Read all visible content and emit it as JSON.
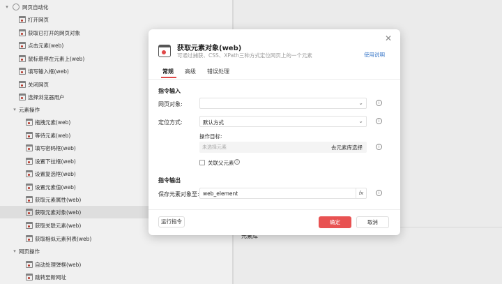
{
  "sidebar": {
    "items": [
      {
        "label": "网页自动化",
        "kind": "group"
      },
      {
        "label": "打开网页",
        "kind": "item"
      },
      {
        "label": "获取已打开的网页对象",
        "kind": "item"
      },
      {
        "label": "点击元素(web)",
        "kind": "item"
      },
      {
        "label": "鼠标悬停在元素上(web)",
        "kind": "item"
      },
      {
        "label": "填写输入框(web)",
        "kind": "item"
      },
      {
        "label": "关闭网页",
        "kind": "item"
      },
      {
        "label": "选择浏览器用户",
        "kind": "item"
      },
      {
        "label": "元素操作",
        "kind": "subgroup"
      },
      {
        "label": "拖拽元素(web)",
        "kind": "subitem"
      },
      {
        "label": "等待元素(web)",
        "kind": "subitem"
      },
      {
        "label": "填写密码框(web)",
        "kind": "subitem"
      },
      {
        "label": "设置下拉框(web)",
        "kind": "subitem"
      },
      {
        "label": "设置复选框(web)",
        "kind": "subitem"
      },
      {
        "label": "设置元素值(web)",
        "kind": "subitem"
      },
      {
        "label": "获取元素属性(web)",
        "kind": "subitem"
      },
      {
        "label": "获取元素对象(web)",
        "kind": "subitem"
      },
      {
        "label": "获取关联元素(web)",
        "kind": "subitem"
      },
      {
        "label": "获取相似元素列表(web)",
        "kind": "subitem"
      },
      {
        "label": "网页操作",
        "kind": "subgroup"
      },
      {
        "label": "自动处理弹框(web)",
        "kind": "subitem"
      },
      {
        "label": "跳转至新网址",
        "kind": "subitem"
      }
    ]
  },
  "background": {
    "element_library_label": "元素库"
  },
  "dialog": {
    "title": "获取元素对象(web)",
    "description": "可通过捕获、CSS、XPath三种方式定位网页上的一个元素",
    "help_link": "使用说明",
    "tabs": [
      "常规",
      "高级",
      "错误处理"
    ],
    "active_tab": "常规",
    "input_section": "指令输入",
    "web_object_label": "网页对象:",
    "web_object_value": "",
    "locate_method_label": "定位方式:",
    "locate_method_value": "默认方式",
    "target_label": "操作目标:",
    "target_placeholder": "未选择元素",
    "pick_element": "去元素库选择",
    "related_parent_label": "关联父元素",
    "output_section": "指令输出",
    "save_label": "保存元素对象至:",
    "save_value": "web_element",
    "fx_label": "fx",
    "run_label": "运行指令",
    "ok_label": "确定",
    "cancel_label": "取消",
    "accent_color": "#e85252"
  }
}
